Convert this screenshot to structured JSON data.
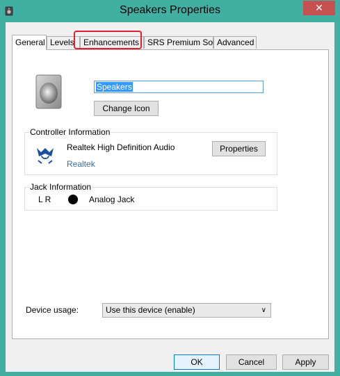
{
  "window": {
    "title": "Speakers Properties",
    "close_glyph": "✕",
    "accent_color": "#41b0a3",
    "close_color": "#c75050"
  },
  "tabs": [
    {
      "label": "General",
      "active": true
    },
    {
      "label": "Levels",
      "active": false
    },
    {
      "label": "Enhancements",
      "active": false
    },
    {
      "label": "SRS Premium Sound",
      "active": false
    },
    {
      "label": "Advanced",
      "active": false
    }
  ],
  "highlight_color": "#e0202e",
  "device": {
    "name_value": "Speakers",
    "change_icon_label": "Change Icon"
  },
  "controller": {
    "group_label": "Controller Information",
    "name": "Realtek High Definition Audio",
    "vendor_link": "Realtek",
    "properties_label": "Properties"
  },
  "jack": {
    "group_label": "Jack Information",
    "channels": "L R",
    "type": "Analog Jack"
  },
  "usage": {
    "label": "Device usage:",
    "selected": "Use this device (enable)"
  },
  "footer": {
    "ok_label": "OK",
    "cancel_label": "Cancel",
    "apply_label": "Apply"
  }
}
